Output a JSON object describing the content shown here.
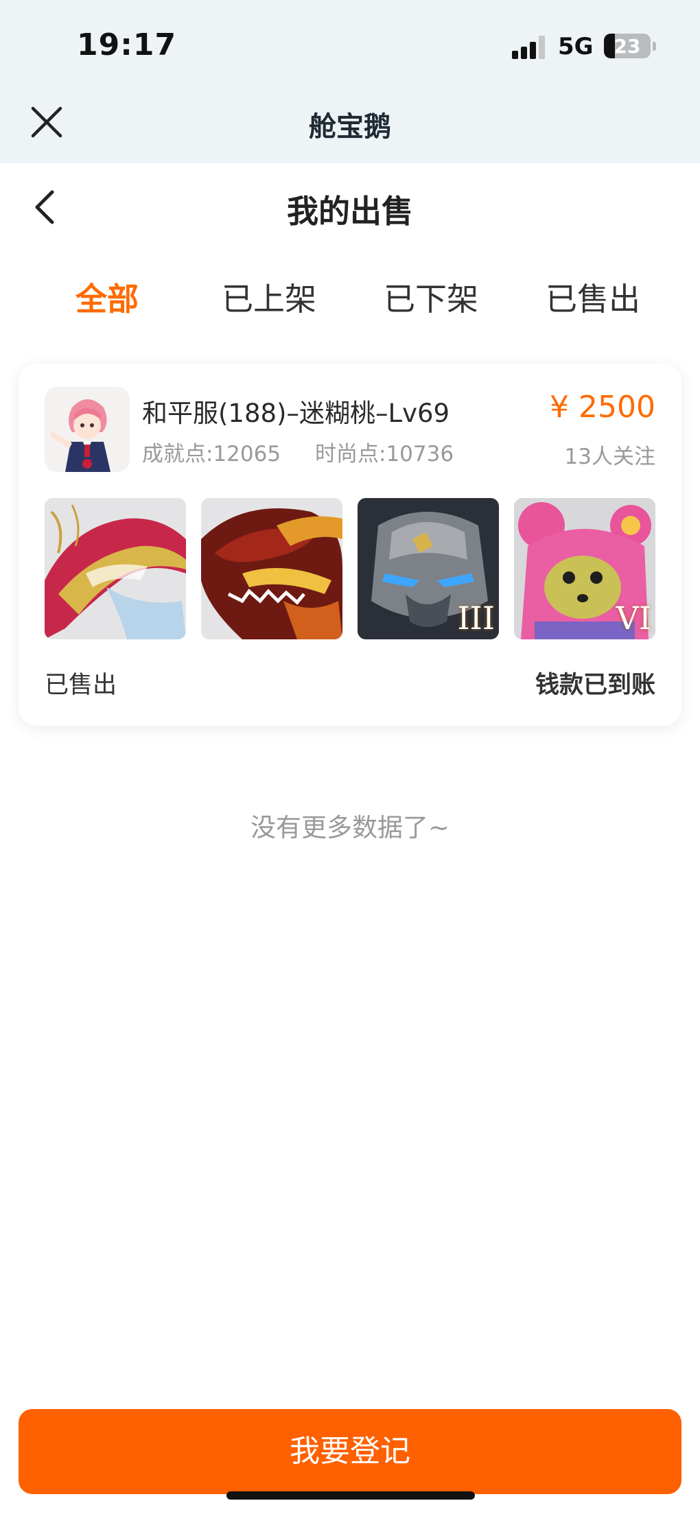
{
  "status_bar": {
    "time": "19:17",
    "network": "5G",
    "battery": "23",
    "battery_level": 0.23
  },
  "app_header": {
    "title": "舱宝鹅",
    "close_icon": "close-icon"
  },
  "page": {
    "title": "我的出售",
    "back_icon": "chevron-left-icon"
  },
  "tabs": [
    {
      "label": "全部",
      "active": true
    },
    {
      "label": "已上架",
      "active": false
    },
    {
      "label": "已下架",
      "active": false
    },
    {
      "label": "已售出",
      "active": false
    }
  ],
  "listing": {
    "title": "和平服(188)–迷糊桃–Lv69",
    "achievement": "成就点:12065",
    "fashion": "时尚点:10736",
    "price": "¥ 2500",
    "followers": "13人关注",
    "thumbnails": [
      {
        "icon": "dragon-skin-icon",
        "badge": ""
      },
      {
        "icon": "fire-dragon-head-icon",
        "badge": ""
      },
      {
        "icon": "stone-mech-helmet-icon",
        "badge": "III"
      },
      {
        "icon": "pink-bear-costume-icon",
        "badge": "VI"
      }
    ],
    "status": "已售出",
    "payment_status": "钱款已到账"
  },
  "no_more_text": "没有更多数据了~",
  "register_button": "我要登记",
  "colors": {
    "accent": "#ff6a00",
    "button": "#ff6000",
    "header_bg": "#eef3f6"
  }
}
